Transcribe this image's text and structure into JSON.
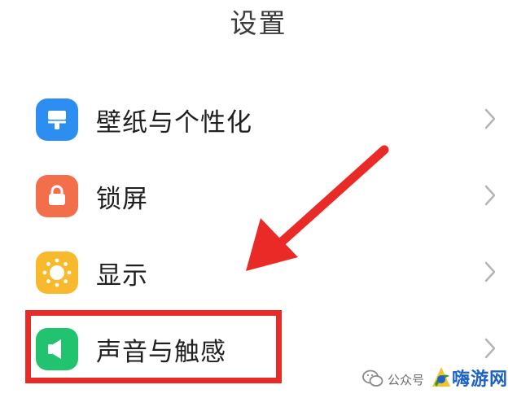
{
  "header": {
    "title": "设置"
  },
  "settings": {
    "items": [
      {
        "label": "壁纸与个性化",
        "icon": "wallpaper-icon",
        "color": "#2d8ef1"
      },
      {
        "label": "锁屏",
        "icon": "lock-icon",
        "color": "#f36e4a"
      },
      {
        "label": "显示",
        "icon": "brightness-icon",
        "color": "#f8b92c"
      },
      {
        "label": "声音与触感",
        "icon": "speaker-icon",
        "color": "#21c36e"
      }
    ]
  },
  "annotation": {
    "highlight_color": "#ea2a26",
    "arrow_color": "#ea2a26"
  },
  "watermark": {
    "account": "公众号",
    "site": "嗨游网"
  }
}
